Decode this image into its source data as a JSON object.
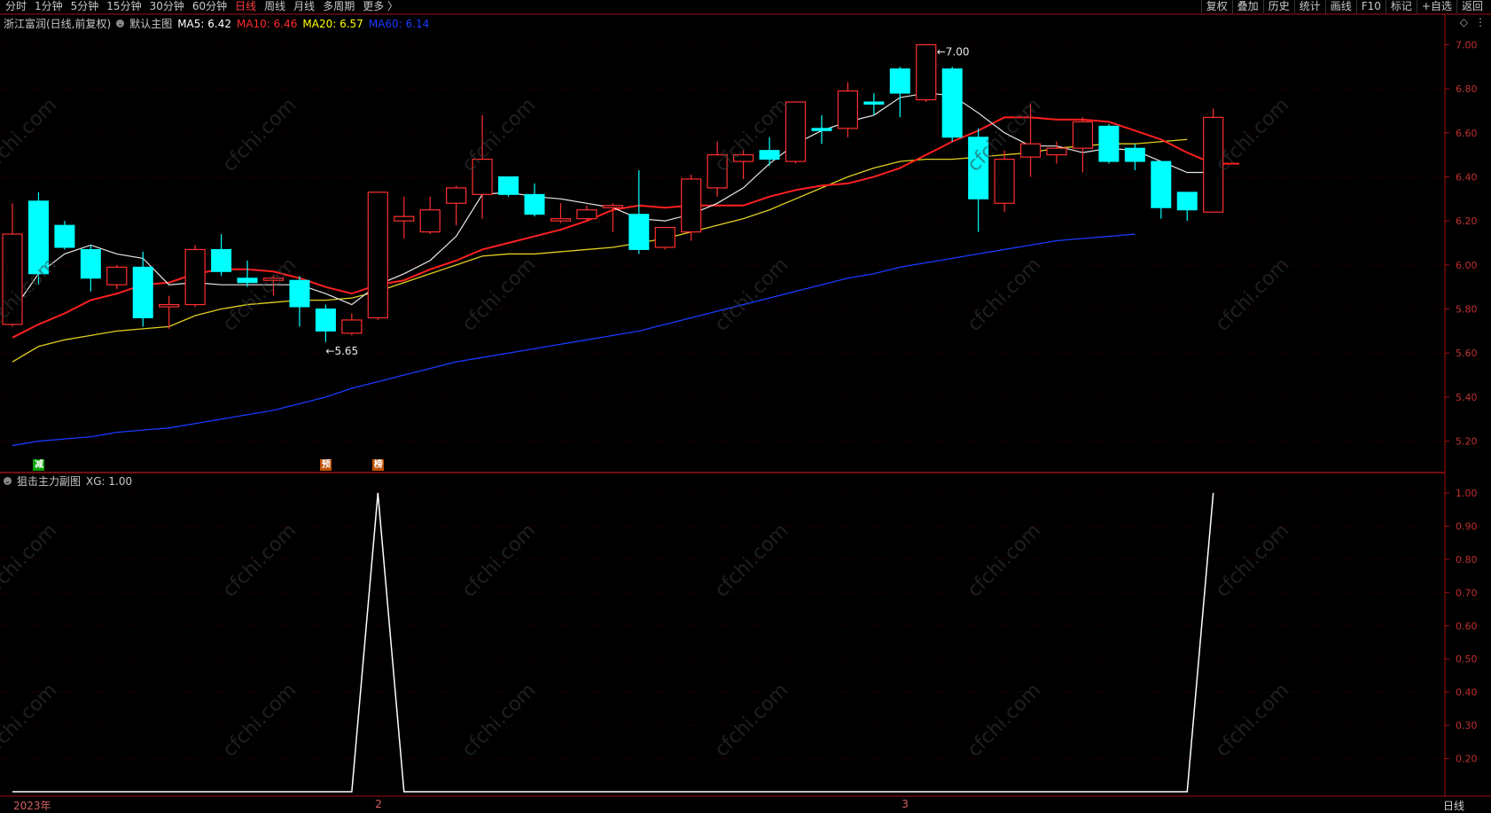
{
  "toolbar": {
    "periods": [
      "分时",
      "1分钟",
      "5分钟",
      "15分钟",
      "30分钟",
      "60分钟",
      "日线",
      "周线",
      "月线",
      "多周期",
      "更多 〉"
    ],
    "active_period": "日线",
    "right_items": [
      "复权",
      "叠加",
      "历史",
      "统计",
      "画线",
      "F10",
      "标记",
      "+自选",
      "返回"
    ]
  },
  "main": {
    "title": "浙江富润(日线,前复权)",
    "indicator_name": "默认主图",
    "ma": [
      {
        "label": "MA5: 6.42",
        "color": "#ffffff"
      },
      {
        "label": "MA10: 6.46",
        "color": "#ff2a2a"
      },
      {
        "label": "MA20: 6.57",
        "color": "#ffff00"
      },
      {
        "label": "MA60: 6.14",
        "color": "#1a3aff"
      }
    ],
    "y_ticks": [
      "7.00",
      "6.80",
      "6.60",
      "6.40",
      "6.20",
      "6.00",
      "5.80",
      "5.60",
      "5.40",
      "5.20"
    ],
    "high_label": "7.00",
    "low_label": "5.65"
  },
  "signals": [
    {
      "text": "减",
      "color": "#00a000",
      "idx": 1
    },
    {
      "text": "预",
      "color": "#c05000",
      "idx": 12
    },
    {
      "text": "榜",
      "color": "#c05000",
      "idx": 14
    }
  ],
  "sub": {
    "title": "狙击主力副图",
    "value_label": "XG: 1.00",
    "y_ticks": [
      "1.00",
      "0.90",
      "0.80",
      "0.70",
      "0.60",
      "0.50",
      "0.40",
      "0.30",
      "0.20"
    ]
  },
  "footer": {
    "year_label": "2023年",
    "month_labels": [
      "2",
      "3"
    ],
    "tab": "日线"
  },
  "watermark": "cfchi.com",
  "chart_data": {
    "type": "candlestick",
    "candles": [
      {
        "o": 5.73,
        "c": 6.14,
        "h": 6.28,
        "l": 5.72
      },
      {
        "o": 6.29,
        "c": 5.96,
        "h": 6.33,
        "l": 5.91
      },
      {
        "o": 6.18,
        "c": 6.08,
        "h": 6.2,
        "l": 6.07
      },
      {
        "o": 6.07,
        "c": 5.94,
        "h": 6.09,
        "l": 5.88
      },
      {
        "o": 5.91,
        "c": 5.99,
        "h": 6.0,
        "l": 5.89
      },
      {
        "o": 5.99,
        "c": 5.76,
        "h": 6.06,
        "l": 5.72
      },
      {
        "o": 5.81,
        "c": 5.82,
        "h": 5.86,
        "l": 5.71
      },
      {
        "o": 5.82,
        "c": 6.07,
        "h": 6.09,
        "l": 5.81
      },
      {
        "o": 6.07,
        "c": 5.97,
        "h": 6.14,
        "l": 5.95
      },
      {
        "o": 5.94,
        "c": 5.92,
        "h": 6.02,
        "l": 5.9
      },
      {
        "o": 5.93,
        "c": 5.94,
        "h": 5.95,
        "l": 5.86
      },
      {
        "o": 5.93,
        "c": 5.81,
        "h": 5.95,
        "l": 5.72
      },
      {
        "o": 5.8,
        "c": 5.7,
        "h": 5.82,
        "l": 5.65
      },
      {
        "o": 5.69,
        "c": 5.75,
        "h": 5.78,
        "l": 5.68
      },
      {
        "o": 5.76,
        "c": 6.33,
        "h": 6.33,
        "l": 5.75
      },
      {
        "o": 6.2,
        "c": 6.22,
        "h": 6.31,
        "l": 6.12
      },
      {
        "o": 6.15,
        "c": 6.25,
        "h": 6.31,
        "l": 6.14
      },
      {
        "o": 6.28,
        "c": 6.35,
        "h": 6.36,
        "l": 6.18
      },
      {
        "o": 6.32,
        "c": 6.48,
        "h": 6.68,
        "l": 6.21
      },
      {
        "o": 6.4,
        "c": 6.32,
        "h": 6.4,
        "l": 6.31
      },
      {
        "o": 6.32,
        "c": 6.23,
        "h": 6.37,
        "l": 6.22
      },
      {
        "o": 6.2,
        "c": 6.21,
        "h": 6.28,
        "l": 6.19
      },
      {
        "o": 6.21,
        "c": 6.25,
        "h": 6.27,
        "l": 6.2
      },
      {
        "o": 6.26,
        "c": 6.27,
        "h": 6.28,
        "l": 6.15
      },
      {
        "o": 6.23,
        "c": 6.07,
        "h": 6.43,
        "l": 6.05
      },
      {
        "o": 6.08,
        "c": 6.17,
        "h": 6.17,
        "l": 6.07
      },
      {
        "o": 6.15,
        "c": 6.39,
        "h": 6.41,
        "l": 6.11
      },
      {
        "o": 6.35,
        "c": 6.5,
        "h": 6.56,
        "l": 6.31
      },
      {
        "o": 6.47,
        "c": 6.5,
        "h": 6.52,
        "l": 6.39
      },
      {
        "o": 6.52,
        "c": 6.48,
        "h": 6.58,
        "l": 6.45
      },
      {
        "o": 6.47,
        "c": 6.74,
        "h": 6.74,
        "l": 6.46
      },
      {
        "o": 6.62,
        "c": 6.61,
        "h": 6.68,
        "l": 6.55
      },
      {
        "o": 6.62,
        "c": 6.79,
        "h": 6.83,
        "l": 6.58
      },
      {
        "o": 6.74,
        "c": 6.73,
        "h": 6.78,
        "l": 6.68
      },
      {
        "o": 6.89,
        "c": 6.78,
        "h": 6.9,
        "l": 6.67
      },
      {
        "o": 6.75,
        "c": 7.0,
        "h": 7.0,
        "l": 6.74
      },
      {
        "o": 6.89,
        "c": 6.58,
        "h": 6.9,
        "l": 6.56
      },
      {
        "o": 6.58,
        "c": 6.3,
        "h": 6.62,
        "l": 6.15
      },
      {
        "o": 6.28,
        "c": 6.48,
        "h": 6.52,
        "l": 6.24
      },
      {
        "o": 6.49,
        "c": 6.55,
        "h": 6.73,
        "l": 6.4
      },
      {
        "o": 6.5,
        "c": 6.53,
        "h": 6.56,
        "l": 6.46
      },
      {
        "o": 6.53,
        "c": 6.65,
        "h": 6.67,
        "l": 6.42
      },
      {
        "o": 6.63,
        "c": 6.47,
        "h": 6.64,
        "l": 6.46
      },
      {
        "o": 6.53,
        "c": 6.47,
        "h": 6.55,
        "l": 6.43
      },
      {
        "o": 6.47,
        "c": 6.26,
        "h": 6.47,
        "l": 6.21
      },
      {
        "o": 6.33,
        "c": 6.25,
        "h": 6.33,
        "l": 6.2
      },
      {
        "o": 6.24,
        "c": 6.67,
        "h": 6.71,
        "l": 6.24
      }
    ],
    "ma5": [
      5.79,
      5.96,
      6.05,
      6.09,
      6.05,
      6.03,
      5.91,
      5.92,
      5.91,
      5.91,
      5.91,
      5.91,
      5.87,
      5.82,
      5.91,
      5.96,
      6.02,
      6.13,
      6.32,
      6.33,
      6.31,
      6.3,
      6.28,
      6.26,
      6.21,
      6.2,
      6.23,
      6.28,
      6.35,
      6.46,
      6.55,
      6.61,
      6.65,
      6.68,
      6.76,
      6.78,
      6.77,
      6.69,
      6.6,
      6.54,
      6.54,
      6.51,
      6.53,
      6.52,
      6.47,
      6.42,
      6.42
    ],
    "ma10": [
      5.67,
      5.73,
      5.78,
      5.84,
      5.87,
      5.91,
      5.92,
      5.96,
      5.98,
      5.98,
      5.97,
      5.94,
      5.9,
      5.87,
      5.91,
      5.93,
      5.98,
      6.02,
      6.07,
      6.1,
      6.13,
      6.16,
      6.2,
      6.25,
      6.27,
      6.26,
      6.27,
      6.27,
      6.27,
      6.31,
      6.34,
      6.36,
      6.37,
      6.4,
      6.44,
      6.5,
      6.56,
      6.61,
      6.67,
      6.67,
      6.66,
      6.66,
      6.65,
      6.61,
      6.57,
      6.51,
      6.46,
      6.46
    ],
    "ma20": [
      5.56,
      5.63,
      5.66,
      5.68,
      5.7,
      5.71,
      5.72,
      5.77,
      5.8,
      5.82,
      5.83,
      5.84,
      5.84,
      5.85,
      5.88,
      5.92,
      5.96,
      6.0,
      6.04,
      6.05,
      6.05,
      6.06,
      6.07,
      6.08,
      6.1,
      6.12,
      6.15,
      6.18,
      6.21,
      6.25,
      6.3,
      6.35,
      6.4,
      6.44,
      6.47,
      6.48,
      6.48,
      6.49,
      6.5,
      6.51,
      6.53,
      6.54,
      6.55,
      6.55,
      6.56,
      6.57
    ],
    "ma60": [
      5.18,
      5.2,
      5.21,
      5.22,
      5.24,
      5.25,
      5.26,
      5.28,
      5.3,
      5.32,
      5.34,
      5.37,
      5.4,
      5.44,
      5.47,
      5.5,
      5.53,
      5.56,
      5.58,
      5.6,
      5.62,
      5.64,
      5.66,
      5.68,
      5.7,
      5.73,
      5.76,
      5.79,
      5.82,
      5.85,
      5.88,
      5.91,
      5.94,
      5.96,
      5.99,
      6.01,
      6.03,
      6.05,
      6.07,
      6.09,
      6.11,
      6.12,
      6.13,
      6.14
    ],
    "xg": [
      0,
      0,
      0,
      0,
      0,
      0,
      0,
      0,
      0,
      0,
      0,
      0,
      0,
      0,
      1,
      0,
      0,
      0,
      0,
      0,
      0,
      0,
      0,
      0,
      0,
      0,
      0,
      0,
      0,
      0,
      0,
      0,
      0,
      0,
      0,
      0,
      0,
      0,
      0,
      0,
      0,
      0,
      0,
      0,
      0,
      0,
      1
    ],
    "main_ylim": [
      5.15,
      7.05
    ],
    "sub_ylim": [
      0.1,
      1.0
    ]
  }
}
